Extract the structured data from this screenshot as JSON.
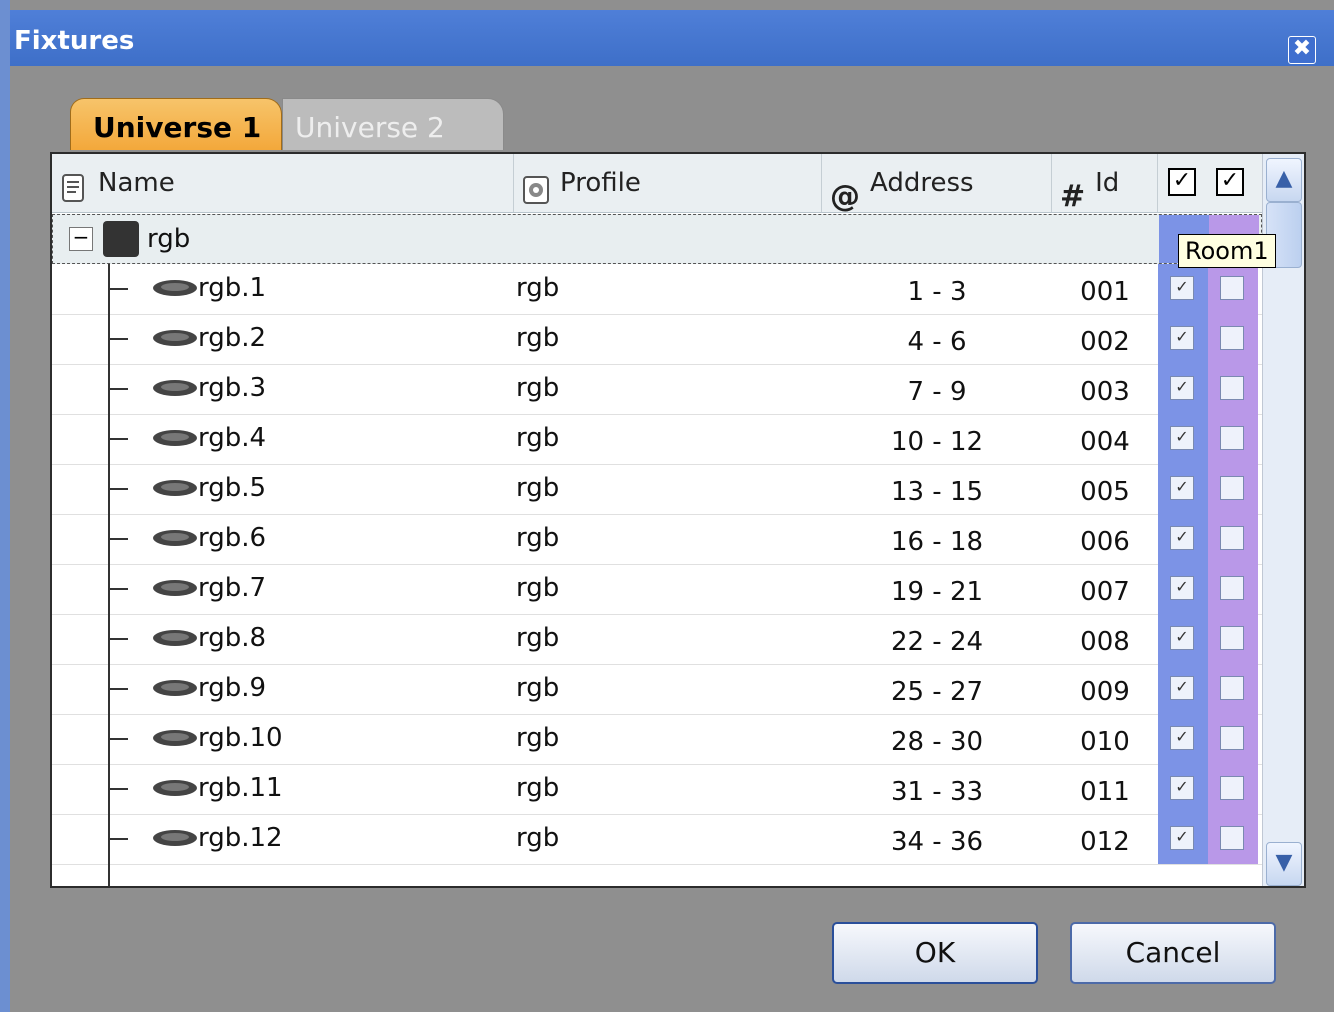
{
  "window": {
    "title": "Fixtures",
    "close_glyph": "✖"
  },
  "tabs": [
    {
      "label": "Universe 1",
      "active": true
    },
    {
      "label": "Universe 2",
      "active": false
    }
  ],
  "columns": {
    "name": {
      "label": "Name",
      "icon": "document-icon"
    },
    "profile": {
      "label": "Profile",
      "icon": "profile-icon"
    },
    "address": {
      "label": "Address",
      "icon_glyph": "@"
    },
    "id": {
      "label": "Id",
      "icon_glyph": "#"
    },
    "check1_glyph": "✓",
    "check2_glyph": "✓"
  },
  "group": {
    "label": "rgb",
    "expander": "−"
  },
  "tooltip": "Room1",
  "rows": [
    {
      "name": "rgb.1",
      "profile": "rgb",
      "address": "1 - 3",
      "id": "001",
      "check1": "✓",
      "check2": ""
    },
    {
      "name": "rgb.2",
      "profile": "rgb",
      "address": "4 - 6",
      "id": "002",
      "check1": "✓",
      "check2": ""
    },
    {
      "name": "rgb.3",
      "profile": "rgb",
      "address": "7 - 9",
      "id": "003",
      "check1": "✓",
      "check2": ""
    },
    {
      "name": "rgb.4",
      "profile": "rgb",
      "address": "10 - 12",
      "id": "004",
      "check1": "✓",
      "check2": ""
    },
    {
      "name": "rgb.5",
      "profile": "rgb",
      "address": "13 - 15",
      "id": "005",
      "check1": "✓",
      "check2": ""
    },
    {
      "name": "rgb.6",
      "profile": "rgb",
      "address": "16 - 18",
      "id": "006",
      "check1": "✓",
      "check2": ""
    },
    {
      "name": "rgb.7",
      "profile": "rgb",
      "address": "19 - 21",
      "id": "007",
      "check1": "✓",
      "check2": ""
    },
    {
      "name": "rgb.8",
      "profile": "rgb",
      "address": "22 - 24",
      "id": "008",
      "check1": "✓",
      "check2": ""
    },
    {
      "name": "rgb.9",
      "profile": "rgb",
      "address": "25 - 27",
      "id": "009",
      "check1": "✓",
      "check2": ""
    },
    {
      "name": "rgb.10",
      "profile": "rgb",
      "address": "28 - 30",
      "id": "010",
      "check1": "✓",
      "check2": ""
    },
    {
      "name": "rgb.11",
      "profile": "rgb",
      "address": "31 - 33",
      "id": "011",
      "check1": "✓",
      "check2": ""
    },
    {
      "name": "rgb.12",
      "profile": "rgb",
      "address": "34 - 36",
      "id": "012",
      "check1": "✓",
      "check2": ""
    }
  ],
  "scrollbar": {
    "up_glyph": "▲",
    "down_glyph": "▼"
  },
  "buttons": {
    "ok": "OK",
    "cancel": "Cancel"
  }
}
